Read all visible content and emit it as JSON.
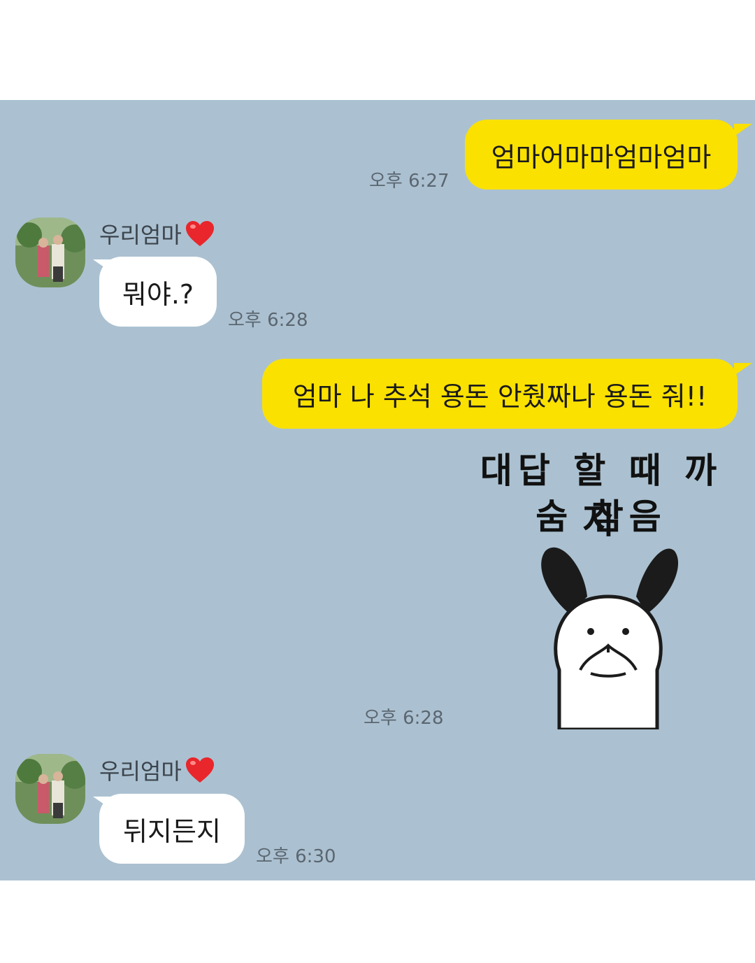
{
  "messages": [
    {
      "text": "엄마어마마엄마엄마",
      "time": "오후 6:27"
    },
    {
      "sender": "우리엄마",
      "text": "뭐야.?",
      "time": "오후 6:28"
    },
    {
      "text": "엄마 나 추석 용돈 안줬짜나 용돈 줘!!"
    },
    {
      "sticker_line1": "대답 할 때 까지",
      "sticker_line2": "숨 참음",
      "time": "오후 6:28"
    },
    {
      "sender": "우리엄마",
      "text": "뒤지든지",
      "time": "오후 6:30"
    }
  ],
  "colors": {
    "chat_bg": "#abc1d1",
    "outgoing_bubble": "#fae100",
    "incoming_bubble": "#ffffff"
  },
  "icons": [
    "heart-icon",
    "avatar-photo",
    "bunny-sticker"
  ]
}
